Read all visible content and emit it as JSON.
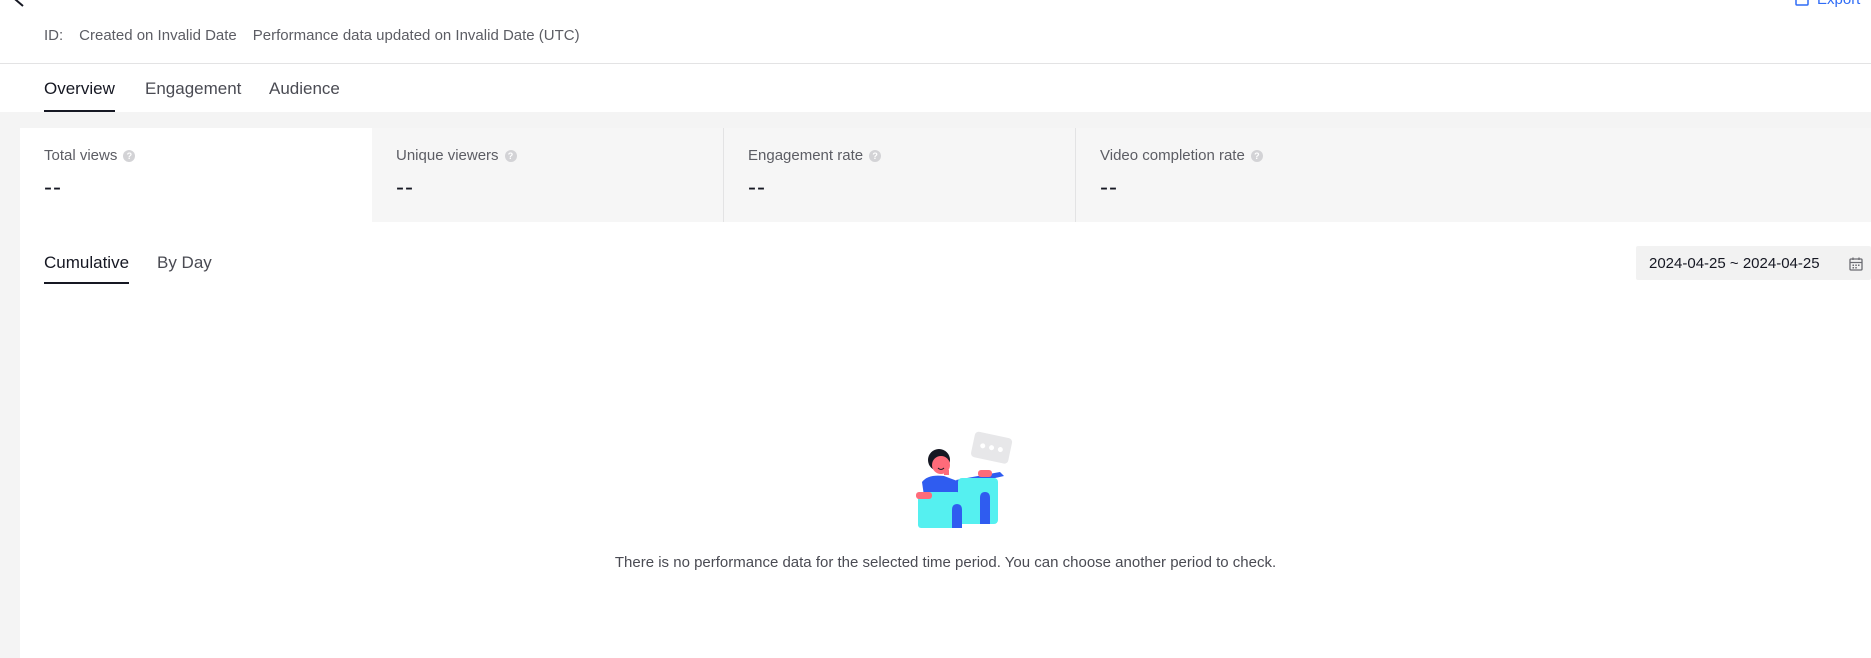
{
  "header": {
    "id_label": "ID:",
    "created": "Created on Invalid Date",
    "updated": "Performance data updated on Invalid Date (UTC)",
    "export_label": "Export"
  },
  "tabs": [
    {
      "label": "Overview",
      "active": true
    },
    {
      "label": "Engagement",
      "active": false
    },
    {
      "label": "Audience",
      "active": false
    }
  ],
  "metrics": [
    {
      "label": "Total views",
      "value": "--",
      "selected": true
    },
    {
      "label": "Unique viewers",
      "value": "--",
      "selected": false
    },
    {
      "label": "Engagement rate",
      "value": "--",
      "selected": false
    },
    {
      "label": "Video completion rate",
      "value": "--",
      "selected": false
    }
  ],
  "subtabs": [
    {
      "label": "Cumulative",
      "active": true
    },
    {
      "label": "By Day",
      "active": false
    }
  ],
  "date_range": "2024-04-25 ~ 2024-04-25",
  "empty_state": {
    "message": "There is no performance data for the selected time period. You can choose another period to check."
  },
  "colors": {
    "accent": "#2f6cf6",
    "empty_art_teal": "#55f0f0",
    "empty_art_blue": "#2f5cf0",
    "empty_art_pink": "#fe6b7a"
  }
}
